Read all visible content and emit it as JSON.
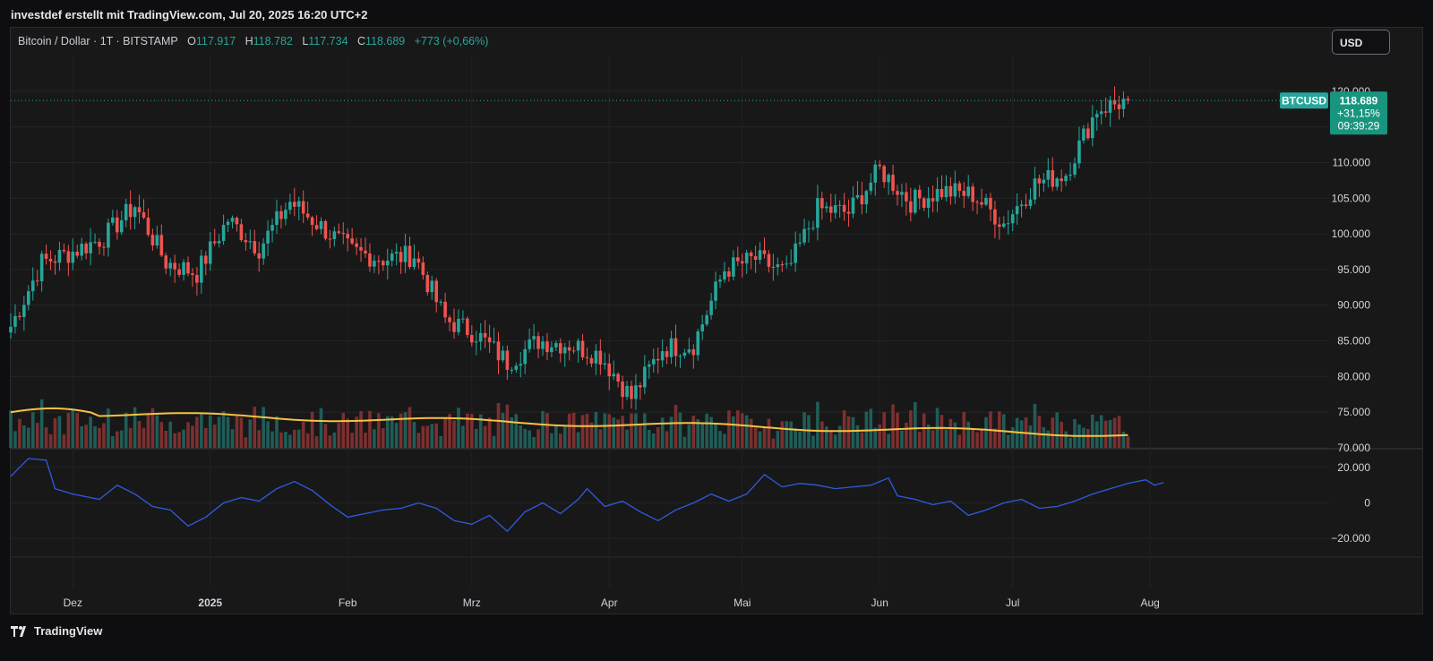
{
  "caption": "investdef erstellt mit TradingView.com, Jul 20, 2025 16:20 UTC+2",
  "legend": {
    "symbol": "Bitcoin / Dollar · 1T · BITSTAMP",
    "o_label": "O",
    "o_value": "117.917",
    "h_label": "H",
    "h_value": "118.782",
    "l_label": "L",
    "l_value": "117.734",
    "c_label": "C",
    "c_value": "118.689",
    "change": "+773 (+0,66%)"
  },
  "currency_button": "USD",
  "price_tag": {
    "symbol": "BTCUSD",
    "price": "118.689",
    "change": "+31,15%",
    "countdown": "09:39:29"
  },
  "brand": "TradingView",
  "colors": {
    "up": "#26a69a",
    "down": "#ef5350",
    "vol_up": "#1f5d58",
    "vol_down": "#7d2f2f",
    "ma": "#f5c242",
    "oscillator": "#2e5ce0",
    "background": "#181818"
  },
  "chart_data": [
    {
      "type": "candlestick",
      "symbol": "BTCUSD",
      "y_axis_ticks": [
        "70.000",
        "75.000",
        "80.000",
        "85.000",
        "90.000",
        "95.000",
        "100.000",
        "105.000",
        "110.000",
        "115.000",
        "120.000"
      ],
      "ylim": [
        70000,
        125000
      ],
      "x_axis_labels": [
        "Dez",
        "2025",
        "Feb",
        "Mrz",
        "Apr",
        "Mai",
        "Jun",
        "Jul",
        "Aug"
      ],
      "x_axis_label_days": [
        14,
        45,
        76,
        104,
        135,
        165,
        196,
        226,
        257
      ],
      "day_zero_note_removed": "",
      "weekly_closes": [
        {
          "day": 0,
          "close": 87000
        },
        {
          "day": 7,
          "close": 96000
        },
        {
          "day": 14,
          "close": 97500
        },
        {
          "day": 21,
          "close": 99500
        },
        {
          "day": 28,
          "close": 104000
        },
        {
          "day": 35,
          "close": 96000
        },
        {
          "day": 42,
          "close": 94500
        },
        {
          "day": 49,
          "close": 102000
        },
        {
          "day": 56,
          "close": 98000
        },
        {
          "day": 63,
          "close": 104500
        },
        {
          "day": 70,
          "close": 101000
        },
        {
          "day": 77,
          "close": 97500
        },
        {
          "day": 84,
          "close": 96500
        },
        {
          "day": 91,
          "close": 97000
        },
        {
          "day": 98,
          "close": 88000
        },
        {
          "day": 105,
          "close": 86000
        },
        {
          "day": 112,
          "close": 82000
        },
        {
          "day": 119,
          "close": 85000
        },
        {
          "day": 126,
          "close": 84500
        },
        {
          "day": 133,
          "close": 83000
        },
        {
          "day": 140,
          "close": 77000
        },
        {
          "day": 147,
          "close": 84000
        },
        {
          "day": 154,
          "close": 84500
        },
        {
          "day": 161,
          "close": 95000
        },
        {
          "day": 168,
          "close": 96500
        },
        {
          "day": 175,
          "close": 94500
        },
        {
          "day": 182,
          "close": 103500
        },
        {
          "day": 189,
          "close": 103000
        },
        {
          "day": 196,
          "close": 109000
        },
        {
          "day": 203,
          "close": 104500
        },
        {
          "day": 210,
          "close": 106000
        },
        {
          "day": 217,
          "close": 105500
        },
        {
          "day": 224,
          "close": 101500
        },
        {
          "day": 231,
          "close": 107000
        },
        {
          "day": 238,
          "close": 108500
        },
        {
          "day": 245,
          "close": 117500
        },
        {
          "day": 252,
          "close": 118689
        }
      ],
      "last_close": 118689
    },
    {
      "type": "bar",
      "name": "Volume",
      "moving_average_level_start": 75000,
      "moving_average_level_end": 71900
    },
    {
      "type": "line",
      "name": "",
      "y_axis_ticks": [
        "20.000",
        "0",
        "−20.000"
      ],
      "ylim": [
        -30000,
        30000
      ],
      "points": [
        {
          "day": 0,
          "y": 15000
        },
        {
          "day": 4,
          "y": 25000
        },
        {
          "day": 8,
          "y": 24000
        },
        {
          "day": 10,
          "y": 8000
        },
        {
          "day": 14,
          "y": 5000
        },
        {
          "day": 20,
          "y": 2000
        },
        {
          "day": 24,
          "y": 10000
        },
        {
          "day": 28,
          "y": 5000
        },
        {
          "day": 32,
          "y": -2000
        },
        {
          "day": 36,
          "y": -4000
        },
        {
          "day": 40,
          "y": -13000
        },
        {
          "day": 44,
          "y": -8000
        },
        {
          "day": 48,
          "y": 0
        },
        {
          "day": 52,
          "y": 3000
        },
        {
          "day": 56,
          "y": 1000
        },
        {
          "day": 60,
          "y": 8000
        },
        {
          "day": 64,
          "y": 12000
        },
        {
          "day": 68,
          "y": 7000
        },
        {
          "day": 72,
          "y": -1000
        },
        {
          "day": 76,
          "y": -8000
        },
        {
          "day": 80,
          "y": -6000
        },
        {
          "day": 84,
          "y": -4000
        },
        {
          "day": 88,
          "y": -3000
        },
        {
          "day": 92,
          "y": 0
        },
        {
          "day": 96,
          "y": -3000
        },
        {
          "day": 100,
          "y": -10000
        },
        {
          "day": 104,
          "y": -12000
        },
        {
          "day": 108,
          "y": -7000
        },
        {
          "day": 112,
          "y": -16000
        },
        {
          "day": 116,
          "y": -5000
        },
        {
          "day": 120,
          "y": 0
        },
        {
          "day": 124,
          "y": -6000
        },
        {
          "day": 128,
          "y": 2000
        },
        {
          "day": 130,
          "y": 8000
        },
        {
          "day": 134,
          "y": -2000
        },
        {
          "day": 138,
          "y": 1000
        },
        {
          "day": 142,
          "y": -5000
        },
        {
          "day": 146,
          "y": -10000
        },
        {
          "day": 150,
          "y": -4000
        },
        {
          "day": 154,
          "y": 0
        },
        {
          "day": 158,
          "y": 5000
        },
        {
          "day": 162,
          "y": 1000
        },
        {
          "day": 166,
          "y": 5000
        },
        {
          "day": 170,
          "y": 16000
        },
        {
          "day": 174,
          "y": 9000
        },
        {
          "day": 178,
          "y": 11000
        },
        {
          "day": 182,
          "y": 10000
        },
        {
          "day": 186,
          "y": 8000
        },
        {
          "day": 190,
          "y": 9000
        },
        {
          "day": 194,
          "y": 10000
        },
        {
          "day": 198,
          "y": 14000
        },
        {
          "day": 200,
          "y": 4000
        },
        {
          "day": 204,
          "y": 2000
        },
        {
          "day": 208,
          "y": -1000
        },
        {
          "day": 212,
          "y": 1000
        },
        {
          "day": 216,
          "y": -7000
        },
        {
          "day": 220,
          "y": -4000
        },
        {
          "day": 224,
          "y": 0
        },
        {
          "day": 228,
          "y": 2000
        },
        {
          "day": 232,
          "y": -3000
        },
        {
          "day": 236,
          "y": -2000
        },
        {
          "day": 240,
          "y": 1000
        },
        {
          "day": 244,
          "y": 5000
        },
        {
          "day": 248,
          "y": 8000
        },
        {
          "day": 252,
          "y": 11000
        },
        {
          "day": 256,
          "y": 13000
        },
        {
          "day": 258,
          "y": 10000
        },
        {
          "day": 260,
          "y": 11500
        }
      ]
    }
  ]
}
